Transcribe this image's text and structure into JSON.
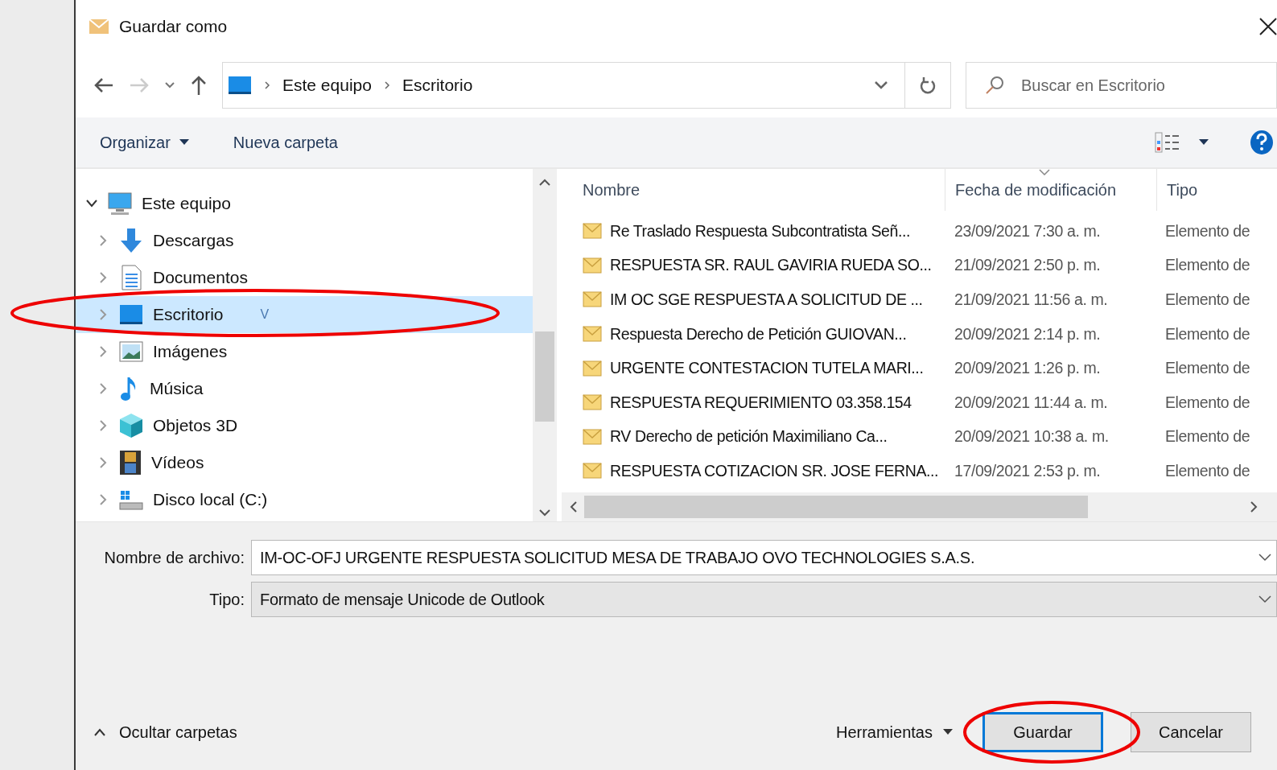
{
  "window": {
    "title": "Guardar como"
  },
  "breadcrumb": [
    "Este equipo",
    "Escritorio"
  ],
  "search": {
    "placeholder": "Buscar en Escritorio"
  },
  "toolbar": {
    "organize": "Organizar",
    "new_folder": "Nueva carpeta"
  },
  "tree": [
    {
      "label": "Este equipo",
      "kind": "computer",
      "expanded": true,
      "selected": false,
      "children": [
        {
          "label": "Descargas",
          "kind": "download",
          "expanded": false,
          "selected": false
        },
        {
          "label": "Documentos",
          "kind": "documents",
          "expanded": false,
          "selected": false
        },
        {
          "label": "Escritorio",
          "kind": "desktop",
          "expanded": false,
          "selected": true,
          "mark": "V"
        },
        {
          "label": "Imágenes",
          "kind": "pictures",
          "expanded": false,
          "selected": false
        },
        {
          "label": "Música",
          "kind": "music",
          "expanded": false,
          "selected": false
        },
        {
          "label": "Objetos 3D",
          "kind": "objects3d",
          "expanded": false,
          "selected": false
        },
        {
          "label": "Vídeos",
          "kind": "videos",
          "expanded": false,
          "selected": false
        },
        {
          "label": "Disco local (C:)",
          "kind": "disk",
          "expanded": false,
          "selected": false
        }
      ]
    }
  ],
  "table": {
    "columns": [
      "Nombre",
      "Fecha de modificación",
      "Tipo"
    ],
    "rows": [
      {
        "name": "Re Traslado Respuesta Subcontratista Señ...",
        "date": "23/09/2021 7:30 a. m.",
        "type": "Elemento de"
      },
      {
        "name": "RESPUESTA SR. RAUL GAVIRIA RUEDA  SO...",
        "date": "21/09/2021 2:50 p. m.",
        "type": "Elemento de"
      },
      {
        "name": "IM OC SGE RESPUESTA A SOLICITUD DE ...",
        "date": "21/09/2021 11:56 a. m.",
        "type": "Elemento de"
      },
      {
        "name": "Respuesta Derecho de Petición GUIOVAN...",
        "date": "20/09/2021 2:14 p. m.",
        "type": "Elemento de"
      },
      {
        "name": "URGENTE CONTESTACION TUTELA  MARI...",
        "date": "20/09/2021 1:26 p. m.",
        "type": "Elemento de"
      },
      {
        "name": "RESPUESTA REQUERIMIENTO 03.358.154",
        "date": "20/09/2021 11:44 a. m.",
        "type": "Elemento de"
      },
      {
        "name": "RV Derecho de petición Maximiliano Ca...",
        "date": "20/09/2021 10:38 a. m.",
        "type": "Elemento de"
      },
      {
        "name": "RESPUESTA COTIZACION SR. JOSE FERNA...",
        "date": "17/09/2021 2:53 p. m.",
        "type": "Elemento de"
      }
    ]
  },
  "filename": {
    "label": "Nombre de archivo:",
    "value": "IM-OC-OFJ URGENTE RESPUESTA SOLICITUD MESA DE TRABAJO OVO TECHNOLOGIES S.A.S."
  },
  "filetype": {
    "label": "Tipo:",
    "value": "Formato de mensaje Unicode de Outlook"
  },
  "hide_folders": "Ocultar carpetas",
  "tools": "Herramientas",
  "buttons": [
    {
      "label": "Guardar",
      "default": true
    },
    {
      "label": "Cancelar",
      "default": false
    }
  ]
}
